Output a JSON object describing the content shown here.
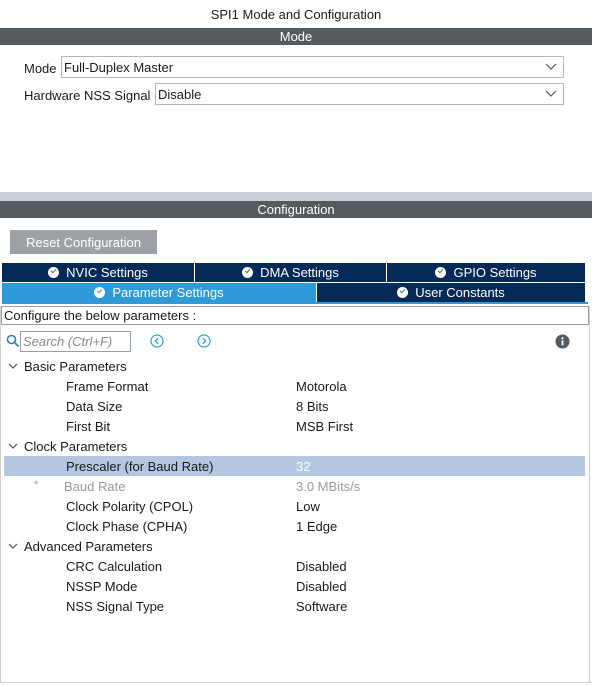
{
  "window": {
    "title": "SPI1 Mode and Configuration"
  },
  "mode_section": {
    "header": "Mode",
    "fields": [
      {
        "label": "Mode",
        "value": "Full-Duplex Master"
      },
      {
        "label": "Hardware NSS Signal",
        "value": "Disable"
      }
    ]
  },
  "config_section": {
    "header": "Configuration",
    "reset_button": "Reset Configuration",
    "tabs_row1": [
      {
        "label": "NVIC Settings"
      },
      {
        "label": "DMA Settings"
      },
      {
        "label": "GPIO Settings"
      }
    ],
    "tabs_row2": [
      {
        "label": "Parameter Settings",
        "active": true
      },
      {
        "label": "User Constants",
        "active": false
      }
    ],
    "instruction": "Configure the below parameters :",
    "search_placeholder": "Search (Ctrl+F)"
  },
  "parameters": {
    "groups": [
      {
        "name": "Basic Parameters",
        "items": [
          {
            "name": "Frame Format",
            "value": "Motorola"
          },
          {
            "name": "Data Size",
            "value": "8 Bits"
          },
          {
            "name": "First Bit",
            "value": "MSB First"
          }
        ]
      },
      {
        "name": "Clock Parameters",
        "items": [
          {
            "name": "Prescaler (for Baud Rate)",
            "value": "32",
            "selected": true
          },
          {
            "name": "Baud Rate",
            "value": "3.0 MBits/s",
            "derived": true,
            "marker": "*"
          },
          {
            "name": "Clock Polarity (CPOL)",
            "value": "Low"
          },
          {
            "name": "Clock Phase (CPHA)",
            "value": "1 Edge"
          }
        ]
      },
      {
        "name": "Advanced Parameters",
        "items": [
          {
            "name": "CRC Calculation",
            "value": "Disabled"
          },
          {
            "name": "NSSP Mode",
            "value": "Disabled"
          },
          {
            "name": "NSS Signal Type",
            "value": "Software"
          }
        ]
      }
    ]
  },
  "colors": {
    "header_bar": "#555a5f",
    "tab_dark": "#062a57",
    "tab_active": "#2f9ad8",
    "selected_row": "#b3c7e0",
    "reset_button": "#9ea2a6"
  },
  "icons": [
    "chevron-down-icon",
    "check-circle-icon",
    "search-icon",
    "previous-icon",
    "next-icon",
    "info-icon",
    "expand-chevron-icon"
  ]
}
